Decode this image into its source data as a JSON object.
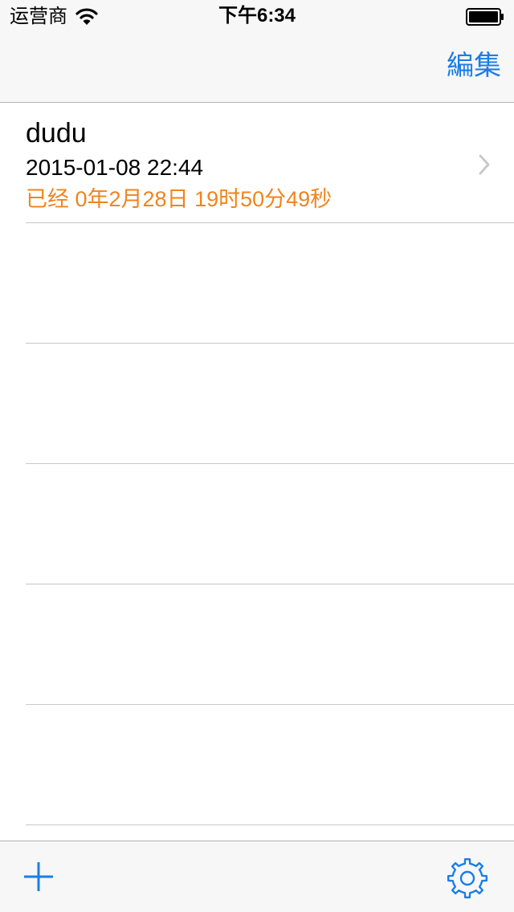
{
  "status_bar": {
    "carrier": "运营商",
    "time": "下午6:34",
    "wifi_icon": "wifi-icon",
    "battery_icon": "battery-icon",
    "battery_level": 1.0
  },
  "nav_bar": {
    "edit_label": "編集"
  },
  "records": [
    {
      "title": "dudu",
      "date": "2015-01-08 22:44",
      "elapsed": "已经 0年2月28日 19时50分49秒",
      "accessory_icon": "chevron-right-icon"
    }
  ],
  "toolbar": {
    "add_icon": "plus-icon",
    "settings_icon": "gear-icon"
  },
  "colors": {
    "accent": "#1a7de8",
    "elapsed": "#f0841c",
    "bar_background": "#f7f7f7",
    "separator": "#c8c7cc"
  }
}
